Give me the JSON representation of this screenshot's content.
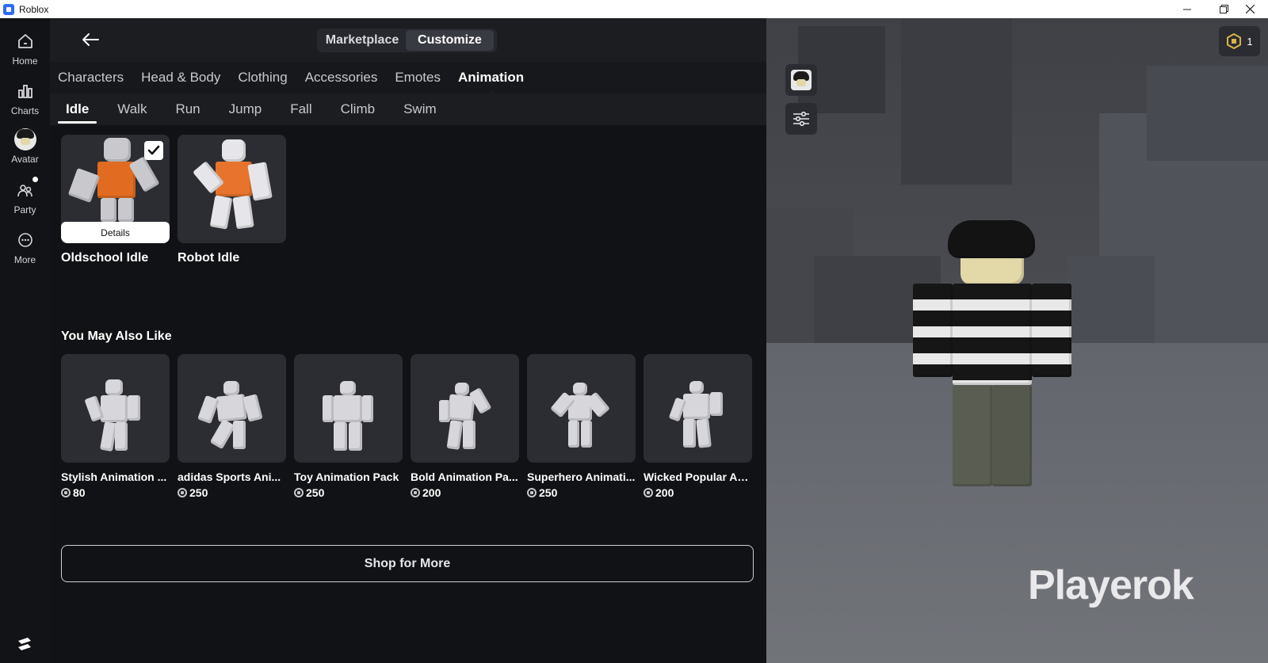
{
  "window": {
    "title": "Roblox",
    "controls": [
      "minimize",
      "restore",
      "close"
    ]
  },
  "rail": {
    "items": [
      {
        "label": "Home",
        "icon": "home-icon"
      },
      {
        "label": "Charts",
        "icon": "charts-icon"
      },
      {
        "label": "Avatar",
        "icon": "avatar-icon"
      },
      {
        "label": "Party",
        "icon": "party-icon"
      },
      {
        "label": "More",
        "icon": "more-icon"
      }
    ]
  },
  "topbar": {
    "tabs": [
      {
        "label": "Marketplace",
        "active": false
      },
      {
        "label": "Customize",
        "active": true
      }
    ]
  },
  "categories": [
    {
      "label": "Characters",
      "active": false
    },
    {
      "label": "Head & Body",
      "active": false
    },
    {
      "label": "Clothing",
      "active": false
    },
    {
      "label": "Accessories",
      "active": false
    },
    {
      "label": "Emotes",
      "active": false
    },
    {
      "label": "Animation",
      "active": true
    }
  ],
  "subcategories": [
    {
      "label": "Idle",
      "active": true
    },
    {
      "label": "Walk",
      "active": false
    },
    {
      "label": "Run",
      "active": false
    },
    {
      "label": "Jump",
      "active": false
    },
    {
      "label": "Fall",
      "active": false
    },
    {
      "label": "Climb",
      "active": false
    },
    {
      "label": "Swim",
      "active": false
    }
  ],
  "owned": {
    "items": [
      {
        "name": "Oldschool Idle",
        "equipped": true,
        "details_label": "Details"
      },
      {
        "name": "Robot Idle",
        "equipped": false
      }
    ]
  },
  "recommendations": {
    "title": "You May Also Like",
    "items": [
      {
        "name": "Stylish Animation ...",
        "price": "80"
      },
      {
        "name": "adidas Sports Ani...",
        "price": "250"
      },
      {
        "name": "Toy Animation Pack",
        "price": "250"
      },
      {
        "name": "Bold Animation Pa...",
        "price": "200"
      },
      {
        "name": "Superhero Animati...",
        "price": "250"
      },
      {
        "name": "Wicked Popular An...",
        "price": "200"
      }
    ]
  },
  "shop_more_label": "Shop for More",
  "viewport": {
    "robux_count": "1",
    "watermark": "Playerok"
  },
  "colors": {
    "background": "#111215",
    "panel": "#1c1d21",
    "card": "#2b2d33",
    "accent_orange": "#e8732c"
  }
}
